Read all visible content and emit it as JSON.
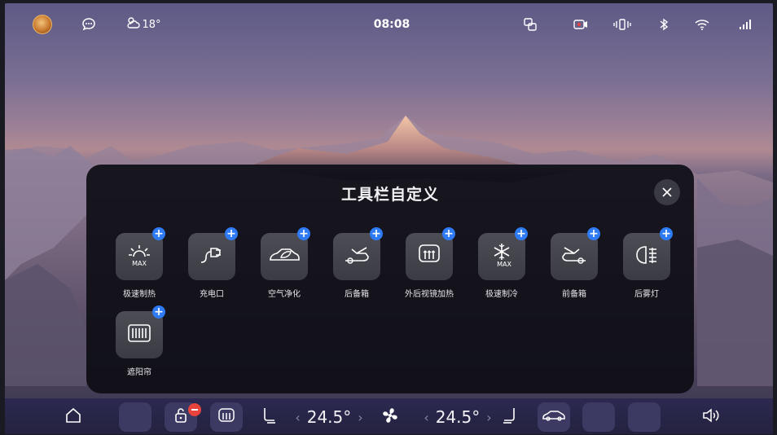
{
  "status_bar": {
    "weather_temp": "18°",
    "time": "08:08",
    "icons": [
      "avatar",
      "chat-bubble-icon",
      "weather-cloud-sun-icon",
      "screen-mirror-icon",
      "camera-record-icon",
      "vibrate-icon",
      "bluetooth-icon",
      "wifi-icon",
      "signal-icon"
    ]
  },
  "panel": {
    "title": "工具栏自定义",
    "close_icon": "close-icon",
    "add_badge": "+",
    "tiles": [
      {
        "label": "极速制热",
        "icon": "sun-max-icon"
      },
      {
        "label": "充电口",
        "icon": "charge-plug-icon"
      },
      {
        "label": "空气净化",
        "icon": "air-purify-icon"
      },
      {
        "label": "后备箱",
        "icon": "rear-trunk-icon"
      },
      {
        "label": "外后视镜加热",
        "icon": "mirror-heat-icon"
      },
      {
        "label": "极速制冷",
        "icon": "snowflake-max-icon"
      },
      {
        "label": "前备箱",
        "icon": "front-trunk-icon"
      },
      {
        "label": "后雾灯",
        "icon": "rear-fog-light-icon"
      },
      {
        "label": "遮阳帘",
        "icon": "sunshade-icon"
      }
    ]
  },
  "dock": {
    "left_temp": "24.5°",
    "right_temp": "24.5°",
    "arrow_left": "‹",
    "arrow_right": "›",
    "icons": [
      "home-icon",
      "lock-icon",
      "rear-defrost-icon",
      "seat-left-icon",
      "fan-icon",
      "seat-right-icon",
      "car-icon",
      "volume-icon"
    ]
  },
  "colors": {
    "accent_blue": "#2f7bf5",
    "badge_red": "#e8433d",
    "panel_bg": "#0e0e16",
    "dock_bg": "#2b2950"
  }
}
